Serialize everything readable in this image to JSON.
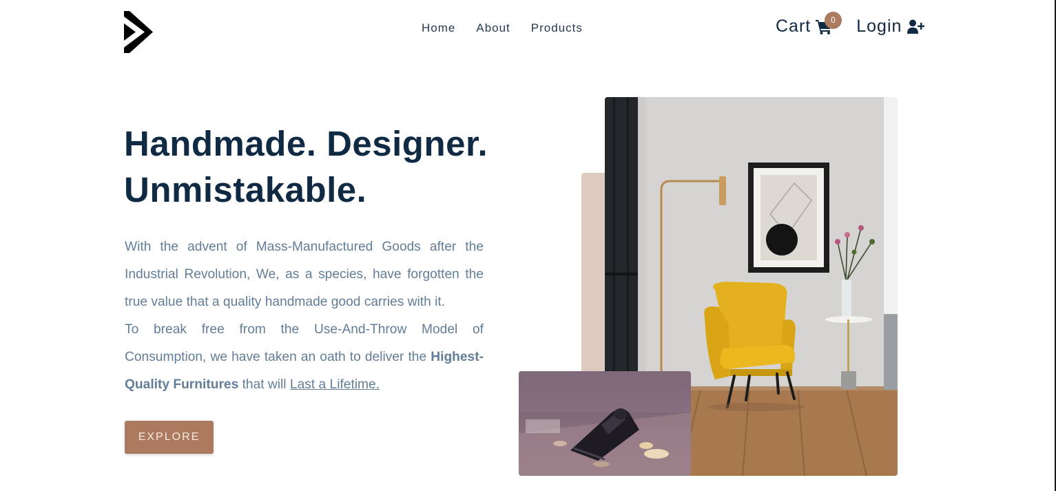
{
  "nav": {
    "logo_icon": "play-chevron-logo",
    "links": [
      {
        "label": "Home"
      },
      {
        "label": "About"
      },
      {
        "label": "Products"
      }
    ],
    "cart": {
      "label": "Cart",
      "icon": "cart-icon",
      "count": "0"
    },
    "login": {
      "label": "Login",
      "icon": "user-plus-icon"
    }
  },
  "hero": {
    "title_line1": "Handmade. Designer.",
    "title_line2": "Unmistakable.",
    "para1": "With the advent of Mass-Manufactured Goods after the Industrial Revolution, We, as a species, have forgotten the true value that a quality handmade good carries with it.",
    "para2_start": "To break free from the Use-And-Throw Model of Consumption, we have taken an oath to deliver the",
    "para2_strong": "Highest-Quality Furnitures",
    "para2_mid": "that will",
    "para2_link": "Last a Lifetime.",
    "cta": "EXPLORE"
  },
  "images": {
    "main": "yellow-armchair-room-photo",
    "small": "hand-plane-woodshavings-photo"
  },
  "colors": {
    "primary": "#ab7a5f",
    "heading": "#102a43",
    "body_text": "#627d98",
    "accent_block": "#decbc0"
  }
}
